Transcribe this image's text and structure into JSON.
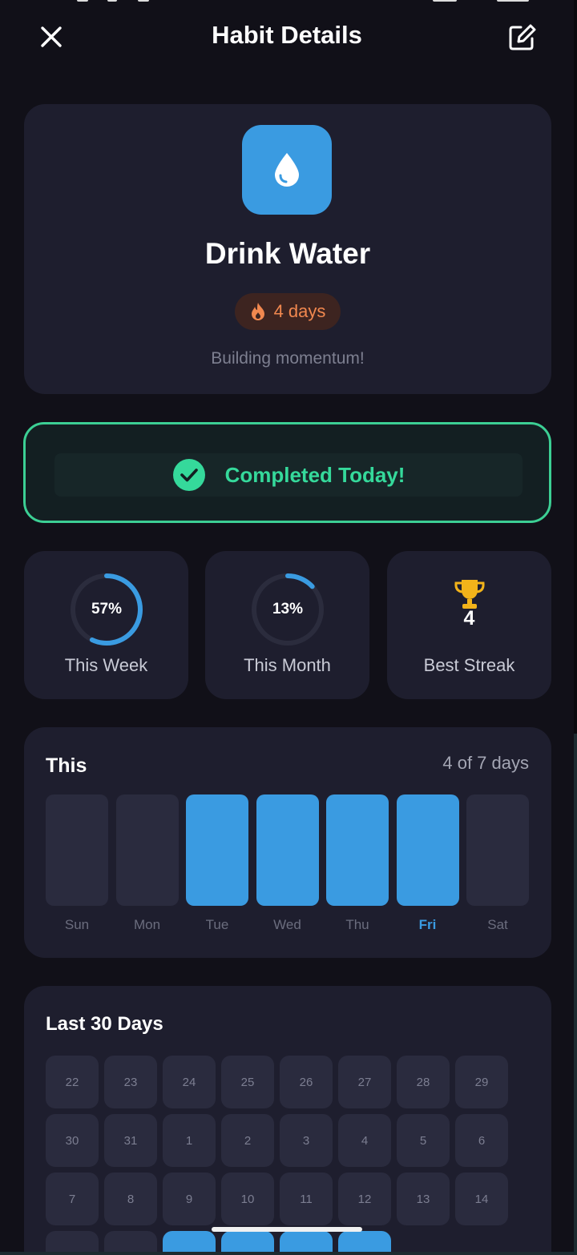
{
  "header": {
    "title": "Habit Details"
  },
  "habit": {
    "name": "Drink Water",
    "streak_text": "4 days",
    "message": "Building momentum!",
    "color": "#3a9be1"
  },
  "completion": {
    "text": "Completed Today!",
    "color": "#35d99b"
  },
  "stats": {
    "week": {
      "percent_text": "57%",
      "percent": 57,
      "label": "This Week"
    },
    "month": {
      "percent_text": "13%",
      "percent": 13,
      "label": "This Month"
    },
    "best": {
      "value": "4",
      "label": "Best Streak"
    }
  },
  "week_card": {
    "title": "This",
    "count_text": "4 of 7 days",
    "days": [
      {
        "label": "Sun",
        "done": false,
        "today": false
      },
      {
        "label": "Mon",
        "done": false,
        "today": false
      },
      {
        "label": "Tue",
        "done": true,
        "today": false
      },
      {
        "label": "Wed",
        "done": true,
        "today": false
      },
      {
        "label": "Thu",
        "done": true,
        "today": false
      },
      {
        "label": "Fri",
        "done": true,
        "today": true
      },
      {
        "label": "Sat",
        "done": false,
        "today": false
      }
    ]
  },
  "month_card": {
    "title": "Last 30 Days",
    "days": [
      {
        "label": "22",
        "done": false
      },
      {
        "label": "23",
        "done": false
      },
      {
        "label": "24",
        "done": false
      },
      {
        "label": "25",
        "done": false
      },
      {
        "label": "26",
        "done": false
      },
      {
        "label": "27",
        "done": false
      },
      {
        "label": "28",
        "done": false
      },
      {
        "label": "29",
        "done": false
      },
      {
        "label": "30",
        "done": false
      },
      {
        "label": "31",
        "done": false
      },
      {
        "label": "1",
        "done": false
      },
      {
        "label": "2",
        "done": false
      },
      {
        "label": "3",
        "done": false
      },
      {
        "label": "4",
        "done": false
      },
      {
        "label": "5",
        "done": false
      },
      {
        "label": "6",
        "done": false
      },
      {
        "label": "7",
        "done": false
      },
      {
        "label": "8",
        "done": false
      },
      {
        "label": "9",
        "done": false
      },
      {
        "label": "10",
        "done": false
      },
      {
        "label": "11",
        "done": false
      },
      {
        "label": "12",
        "done": false
      },
      {
        "label": "13",
        "done": false
      },
      {
        "label": "14",
        "done": false
      },
      {
        "label": "",
        "done": false
      },
      {
        "label": "",
        "done": false
      },
      {
        "label": "",
        "done": true
      },
      {
        "label": "",
        "done": true
      },
      {
        "label": "",
        "done": true
      },
      {
        "label": "",
        "done": true
      }
    ]
  }
}
